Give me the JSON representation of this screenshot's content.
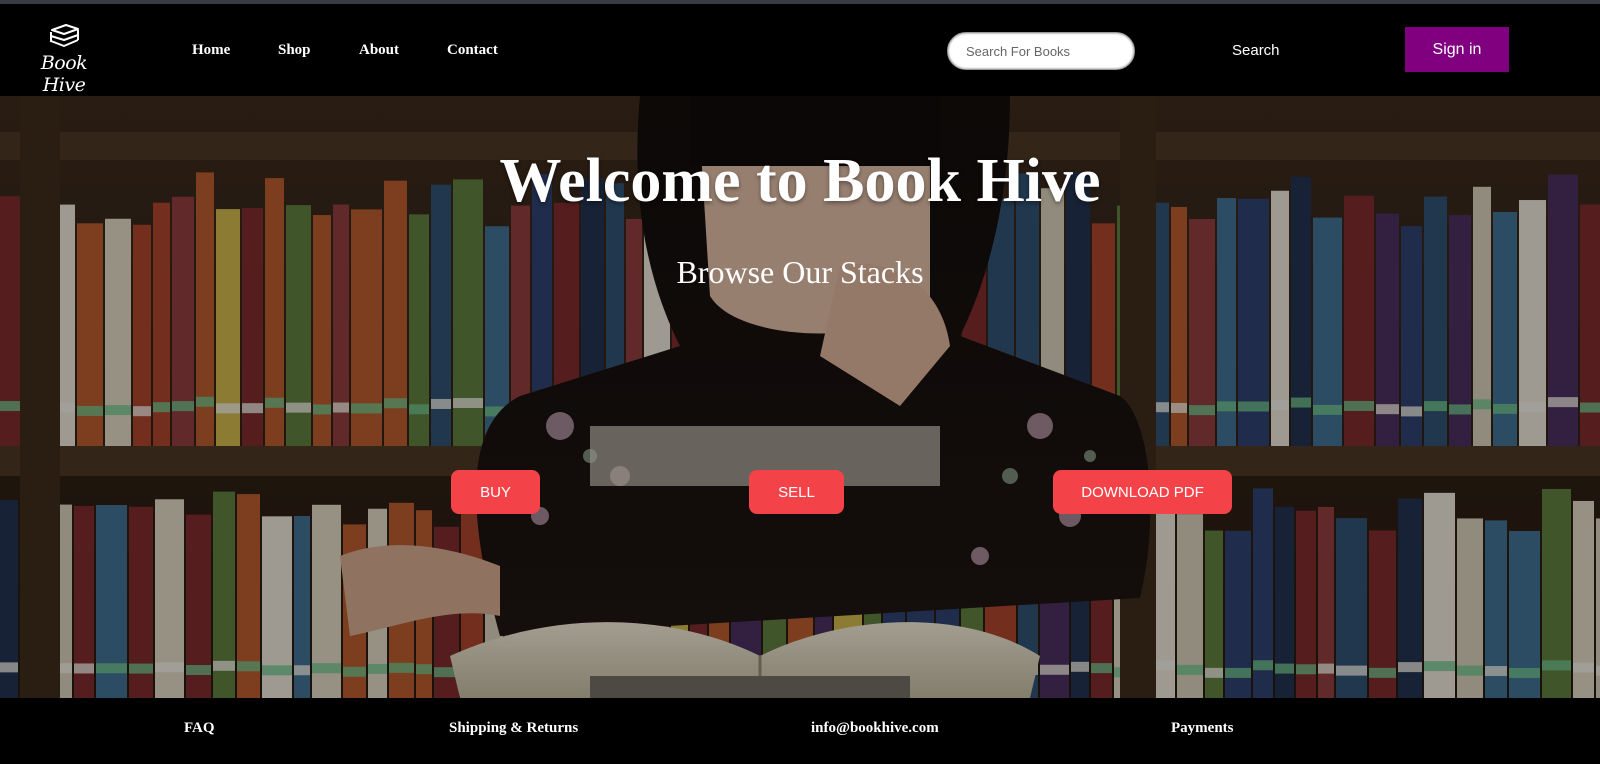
{
  "brand": {
    "name": "Book Hive",
    "icon": "book-stack-icon"
  },
  "nav": {
    "items": [
      {
        "label": "Home"
      },
      {
        "label": "Shop"
      },
      {
        "label": "About"
      },
      {
        "label": "Contact"
      }
    ]
  },
  "search": {
    "placeholder": "Search For Books",
    "value": "",
    "button_label": "Search"
  },
  "signin": {
    "label": "Sign in",
    "color": "#800080"
  },
  "hero": {
    "title": "Welcome to Book Hive",
    "subtitle": "Browse Our Stacks",
    "buttons": [
      {
        "label": "BUY"
      },
      {
        "label": "SELL"
      },
      {
        "label": "DOWNLOAD PDF"
      }
    ],
    "button_color": "#f44348"
  },
  "footer": {
    "links": [
      {
        "label": "FAQ"
      },
      {
        "label": "Shipping & Returns"
      },
      {
        "label": "info@bookhive.com"
      },
      {
        "label": "Payments"
      }
    ]
  }
}
